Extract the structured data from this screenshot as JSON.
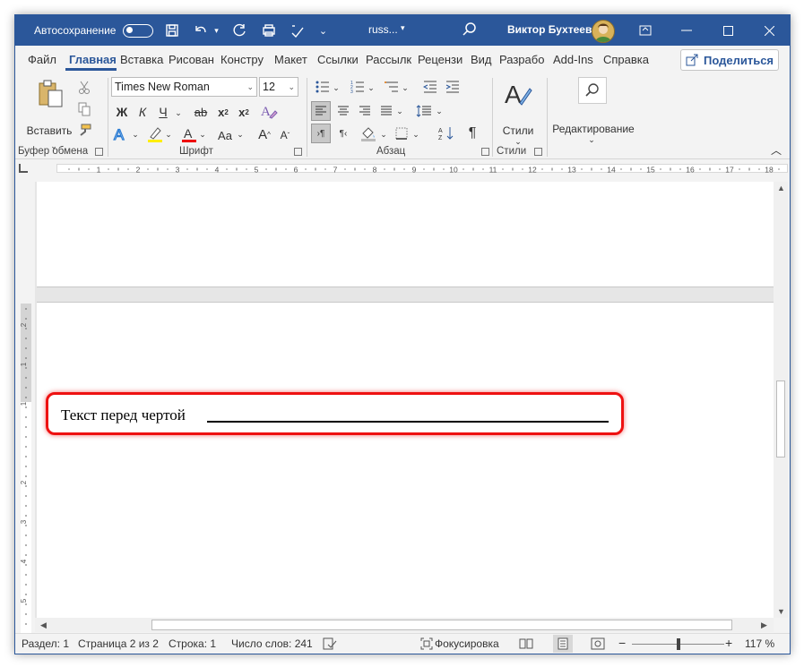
{
  "titlebar": {
    "autosave_label": "Автосохранение",
    "doc_name": "russ...",
    "user_name": "Виктор Бухтеев"
  },
  "menu": {
    "items": [
      "Файл",
      "Главная",
      "Вставка",
      "Рисован",
      "Констру",
      "Макет",
      "Ссылки",
      "Рассылк",
      "Рецензи",
      "Вид",
      "Разрабо",
      "Add-Ins",
      "Справка"
    ],
    "active_index": 1,
    "share_label": "Поделиться"
  },
  "ribbon": {
    "clipboard": {
      "paste_label": "Вставить",
      "group_label": "Буфер обмена"
    },
    "font": {
      "font_name": "Times New Roman",
      "font_size": "12",
      "group_label": "Шрифт",
      "bold": "Ж",
      "italic": "К",
      "underline": "Ч",
      "strike": "ab",
      "sub": "x",
      "sup": "x",
      "grow": "A",
      "shrink": "A",
      "case": "Aa"
    },
    "paragraph": {
      "group_label": "Абзац",
      "pilcrow": "¶"
    },
    "styles": {
      "label": "Стили",
      "group_label": "Стили"
    },
    "editing": {
      "label": "Редактирование"
    }
  },
  "ruler": {
    "numbers": [
      "1",
      "2",
      "3",
      "4",
      "5",
      "6",
      "7",
      "8",
      "9",
      "10",
      "11",
      "12",
      "13",
      "14",
      "15",
      "16",
      "17",
      "18"
    ]
  },
  "vruler": {
    "numbers": [
      "2",
      "1",
      "1",
      "2",
      "3",
      "4",
      "5"
    ]
  },
  "document": {
    "text": "Текст перед чертой"
  },
  "status": {
    "section": "Раздел: 1",
    "page": "Страница 2 из 2",
    "line": "Строка: 1",
    "words": "Число слов: 241",
    "focus": "Фокусировка",
    "zoom": "117 %",
    "zoom_minus": "−",
    "zoom_plus": "+"
  },
  "colors": {
    "accent": "#2b579a",
    "highlight_border": "#e11111"
  }
}
